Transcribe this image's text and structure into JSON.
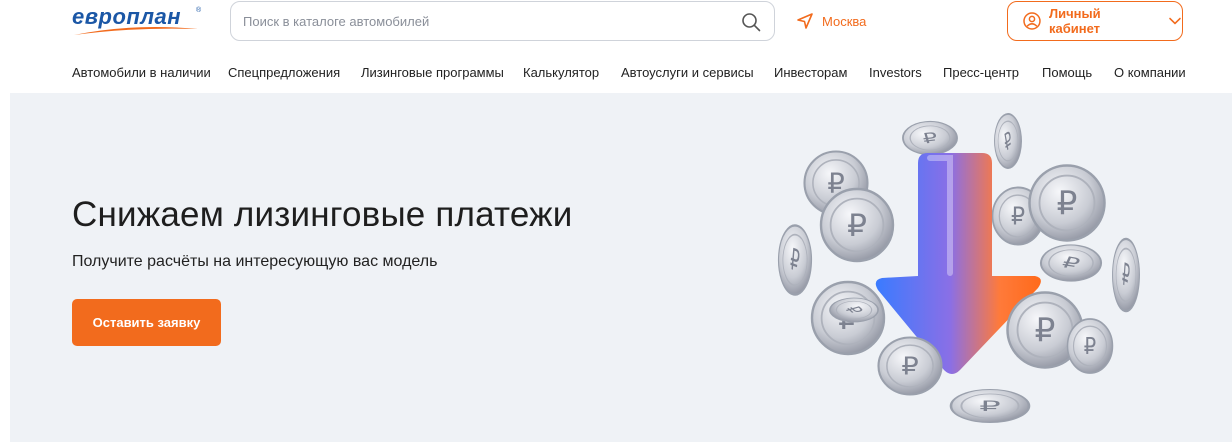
{
  "header": {
    "logo_text": "европлан",
    "logo_reg": "®",
    "search": {
      "placeholder": "Поиск в каталоге автомобилей"
    },
    "city": "Москва",
    "cabinet_label": "Личный кабинет"
  },
  "nav": {
    "items": [
      "Автомобили в наличии",
      "Спецпредложения",
      "Лизинговые программы",
      "Калькулятор",
      "Автоуслуги и сервисы",
      "Инвесторам",
      "Investors",
      "Пресс-центр",
      "Помощь",
      "О компании"
    ]
  },
  "hero": {
    "title": "Снижаем лизинговые платежи",
    "subtitle": "Получите расчёты на интересующую вас модель",
    "button": "Оставить заявку"
  },
  "colors": {
    "accent": "#f26b1d",
    "brand": "#1b57a6",
    "hero_bg": "#eff2f6"
  },
  "icons": {
    "search": "search-icon",
    "city": "location-arrow-icon",
    "cabinet": "user-circle-icon",
    "chevron": "chevron-down-icon"
  }
}
